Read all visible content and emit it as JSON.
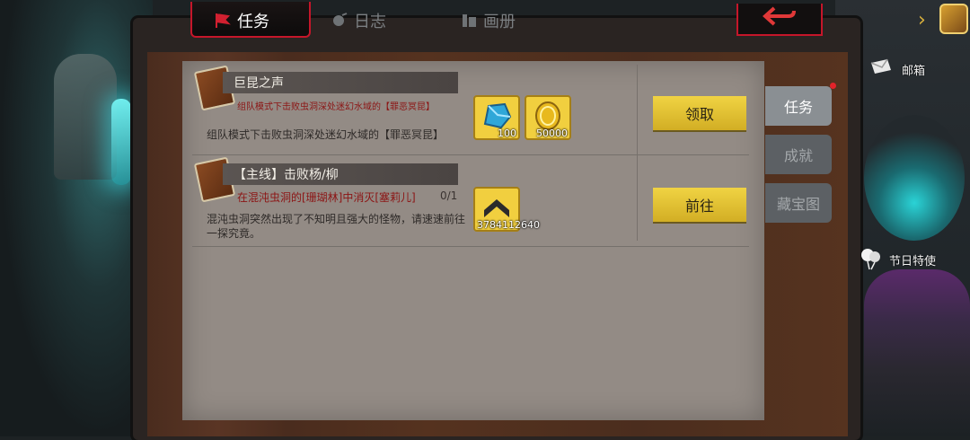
{
  "tabs": [
    {
      "label": "任务",
      "icon": "quest-flag-icon",
      "active": true
    },
    {
      "label": "日志",
      "icon": "journal-icon",
      "active": false
    },
    {
      "label": "画册",
      "icon": "album-icon",
      "active": false
    }
  ],
  "side_tabs": [
    {
      "label": "任务",
      "active": true,
      "badge": true
    },
    {
      "label": "成就",
      "active": false
    },
    {
      "label": "藏宝图",
      "active": false
    }
  ],
  "quests": [
    {
      "title": "巨昆之声",
      "subtitle": "组队模式下击败虫洞深处迷幻水域的【罪恶冥昆】",
      "progress": "",
      "description": "组队模式下击败虫洞深处迷幻水域的【罪恶冥昆】",
      "rewards": [
        {
          "icon": "crystal-icon",
          "amount": "100",
          "color": "#2fa7d8"
        },
        {
          "icon": "gold-coin-icon",
          "amount": "50000",
          "color": "#e8b91e"
        }
      ],
      "action": "领取"
    },
    {
      "title": "【主线】击败杨/柳",
      "subtitle": "在混沌虫洞的[珊瑚林]中消灭[塞莉儿]",
      "progress": "0/1",
      "description": "混沌虫洞突然出现了不知明且强大的怪物，请速速前往一探究竟。",
      "rewards": [
        {
          "icon": "rank-up-icon",
          "amount": "3784112640",
          "color": "#2b2b2b"
        }
      ],
      "action": "前往"
    }
  ],
  "right_panel": {
    "mailbox_label": "邮箱",
    "event_label": "节日特使"
  },
  "colors": {
    "accent_red": "#c5162a",
    "button_yellow": "#f0d343",
    "panel": "#938b85"
  }
}
